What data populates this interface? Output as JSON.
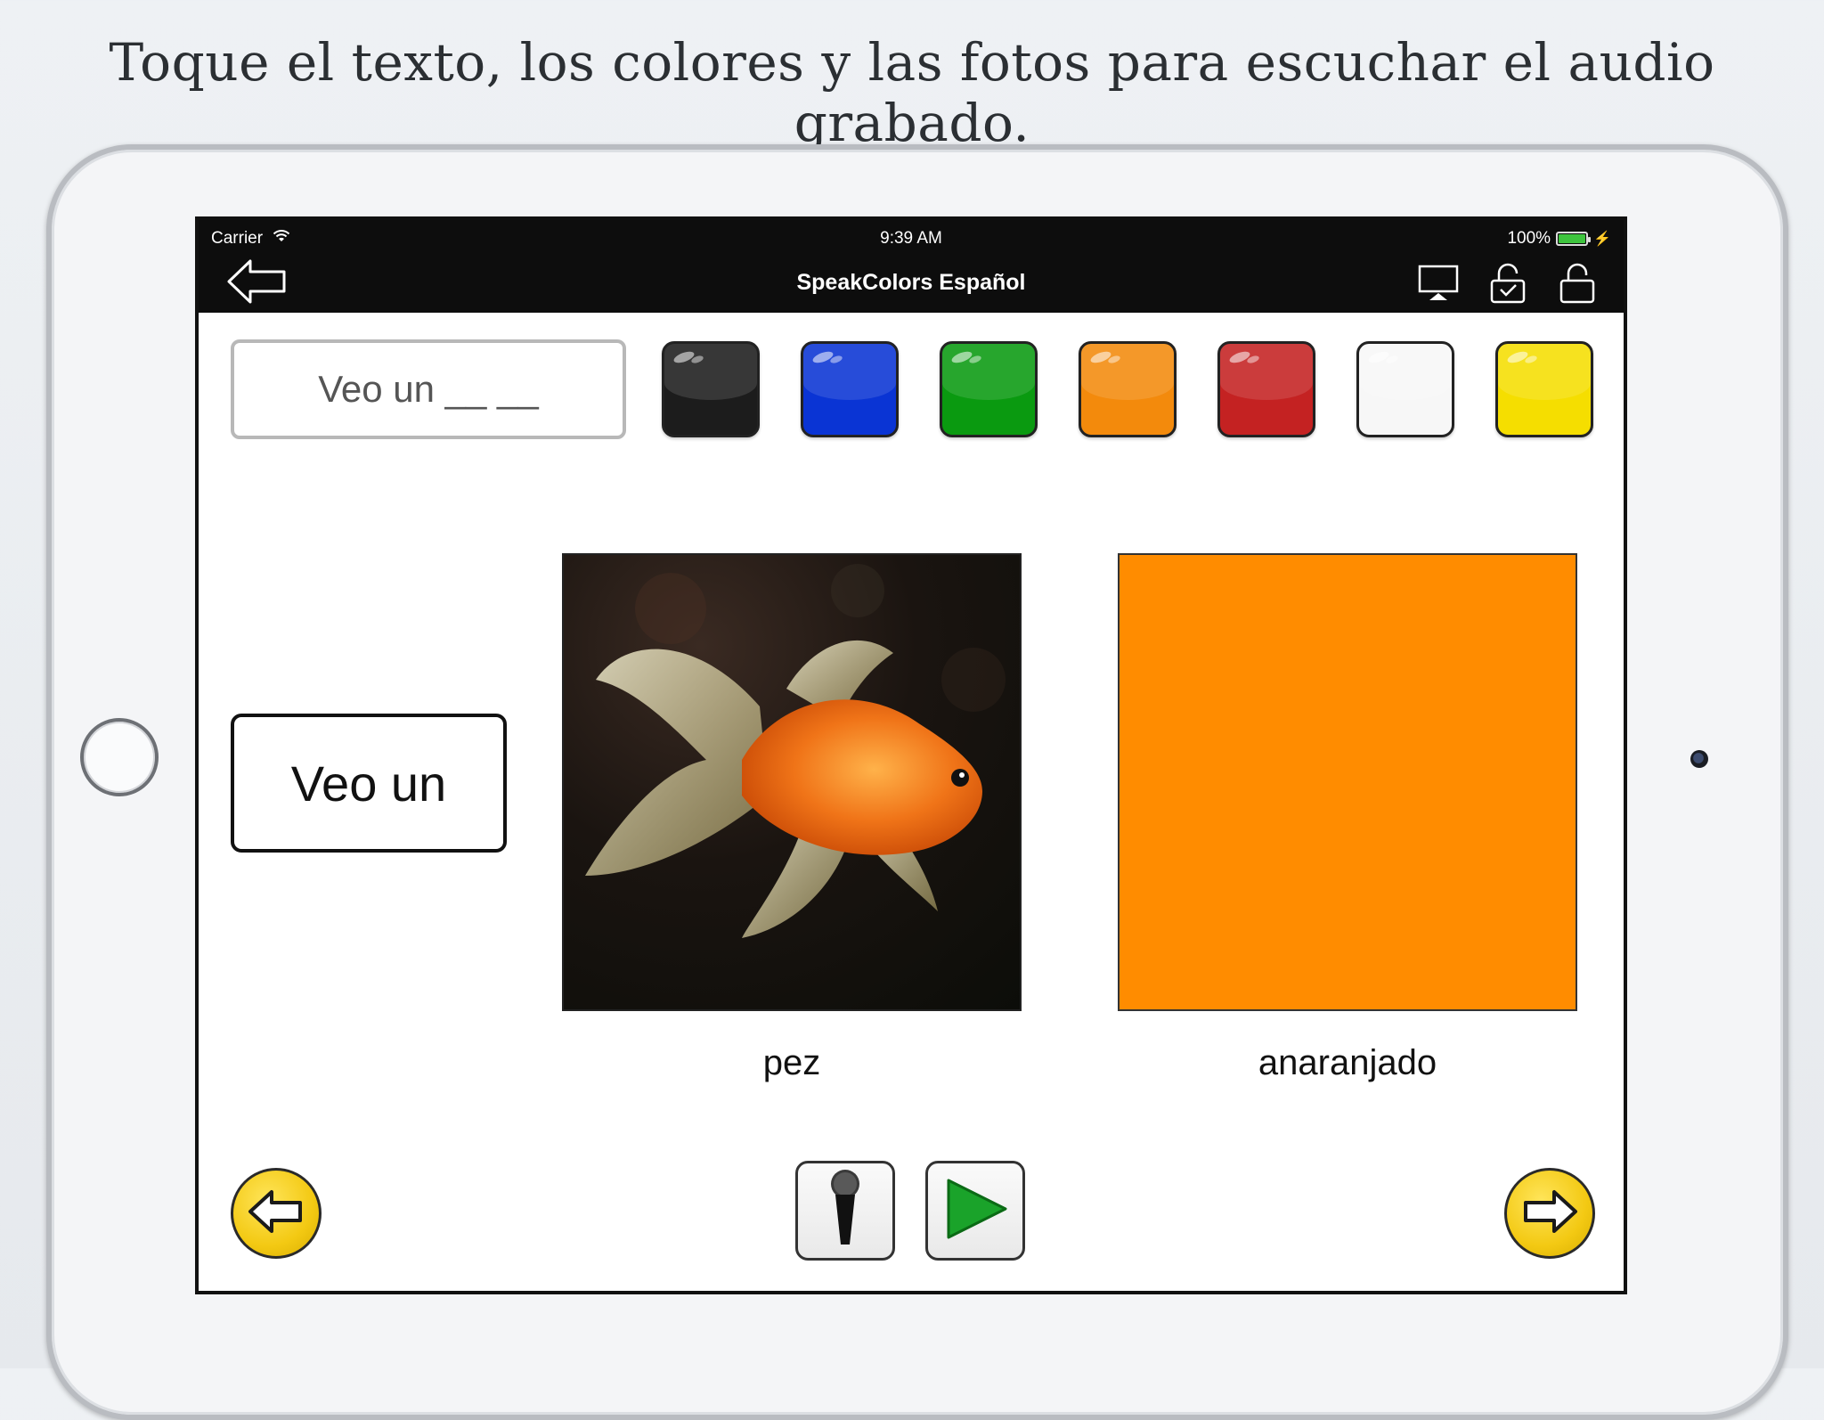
{
  "headline": "Toque el texto, los colores y las fotos para escuchar el audio grabado.",
  "status_bar": {
    "carrier": "Carrier",
    "time": "9:39 AM",
    "battery": "100%"
  },
  "nav": {
    "title": "SpeakColors Español",
    "back_icon": "back-arrow-icon",
    "right_icons": [
      "airplay-icon",
      "unlock-check-icon",
      "unlock-icon"
    ]
  },
  "sentence_field": {
    "text": "Veo un __ __"
  },
  "swatches": [
    {
      "name": "black",
      "color": "#1c1c1c"
    },
    {
      "name": "blue",
      "color": "#0a34d4"
    },
    {
      "name": "green",
      "color": "#0a9a10"
    },
    {
      "name": "orange",
      "color": "#f38a0c"
    },
    {
      "name": "red",
      "color": "#c42222"
    },
    {
      "name": "white",
      "color": "#f7f7f7"
    },
    {
      "name": "yellow",
      "color": "#f5de00"
    }
  ],
  "word_box": {
    "text": "Veo un"
  },
  "photo": {
    "label": "pez",
    "icon": "goldfish-photo"
  },
  "color_card": {
    "label": "anaranjado",
    "color": "#ff8c00"
  },
  "controls": {
    "prev_icon": "left-arrow-icon",
    "next_icon": "right-arrow-icon",
    "mic_icon": "microphone-icon",
    "play_icon": "play-icon"
  }
}
